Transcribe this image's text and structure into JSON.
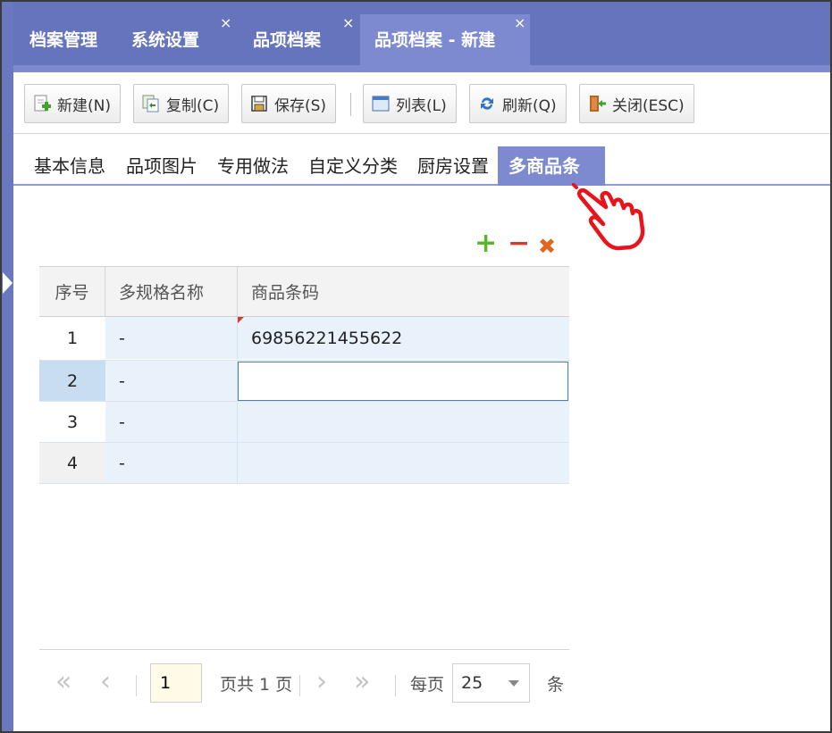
{
  "tabs": [
    {
      "label": "档案管理",
      "closable": false,
      "active": false
    },
    {
      "label": "系统设置",
      "closable": true,
      "active": false
    },
    {
      "label": "品项档案",
      "closable": true,
      "active": false
    },
    {
      "label": "品项档案 - 新建",
      "closable": true,
      "active": true
    }
  ],
  "tab_close_glyph": "×",
  "toolbar": {
    "new_label": "新建(N)",
    "copy_label": "复制(C)",
    "save_label": "保存(S)",
    "list_label": "列表(L)",
    "refresh_label": "刷新(Q)",
    "close_label": "关闭(ESC)"
  },
  "subtabs": [
    {
      "label": "基本信息"
    },
    {
      "label": "品项图片"
    },
    {
      "label": "专用做法"
    },
    {
      "label": "自定义分类"
    },
    {
      "label": "厨房设置"
    },
    {
      "label": "多商品条码",
      "active": true
    }
  ],
  "grid_actions": {
    "add": "+",
    "remove": "−",
    "delete": "✖"
  },
  "grid": {
    "columns": [
      "序号",
      "多规格名称",
      "商品条码"
    ],
    "rows": [
      {
        "index": "1",
        "spec": "-",
        "barcode": "69856221455622"
      },
      {
        "index": "2",
        "spec": "-",
        "barcode": ""
      },
      {
        "index": "3",
        "spec": "-",
        "barcode": ""
      },
      {
        "index": "4",
        "spec": "-",
        "barcode": ""
      }
    ]
  },
  "pager": {
    "page_input": "1",
    "page_total_text": "页共 1 页",
    "per_page_label": "每页",
    "page_size": "25",
    "unit_label": "条"
  },
  "colors": {
    "tabbar": "#6574bd",
    "active_tab": "#7d8ad0",
    "row_selected_index": "#c9ddf0",
    "row_bg": "#e9f2fb",
    "add_icon": "#5ab52c",
    "remove_icon": "#d63a2a",
    "delete_icon": "#e2661e",
    "hand_pointer": "#e8141b"
  }
}
